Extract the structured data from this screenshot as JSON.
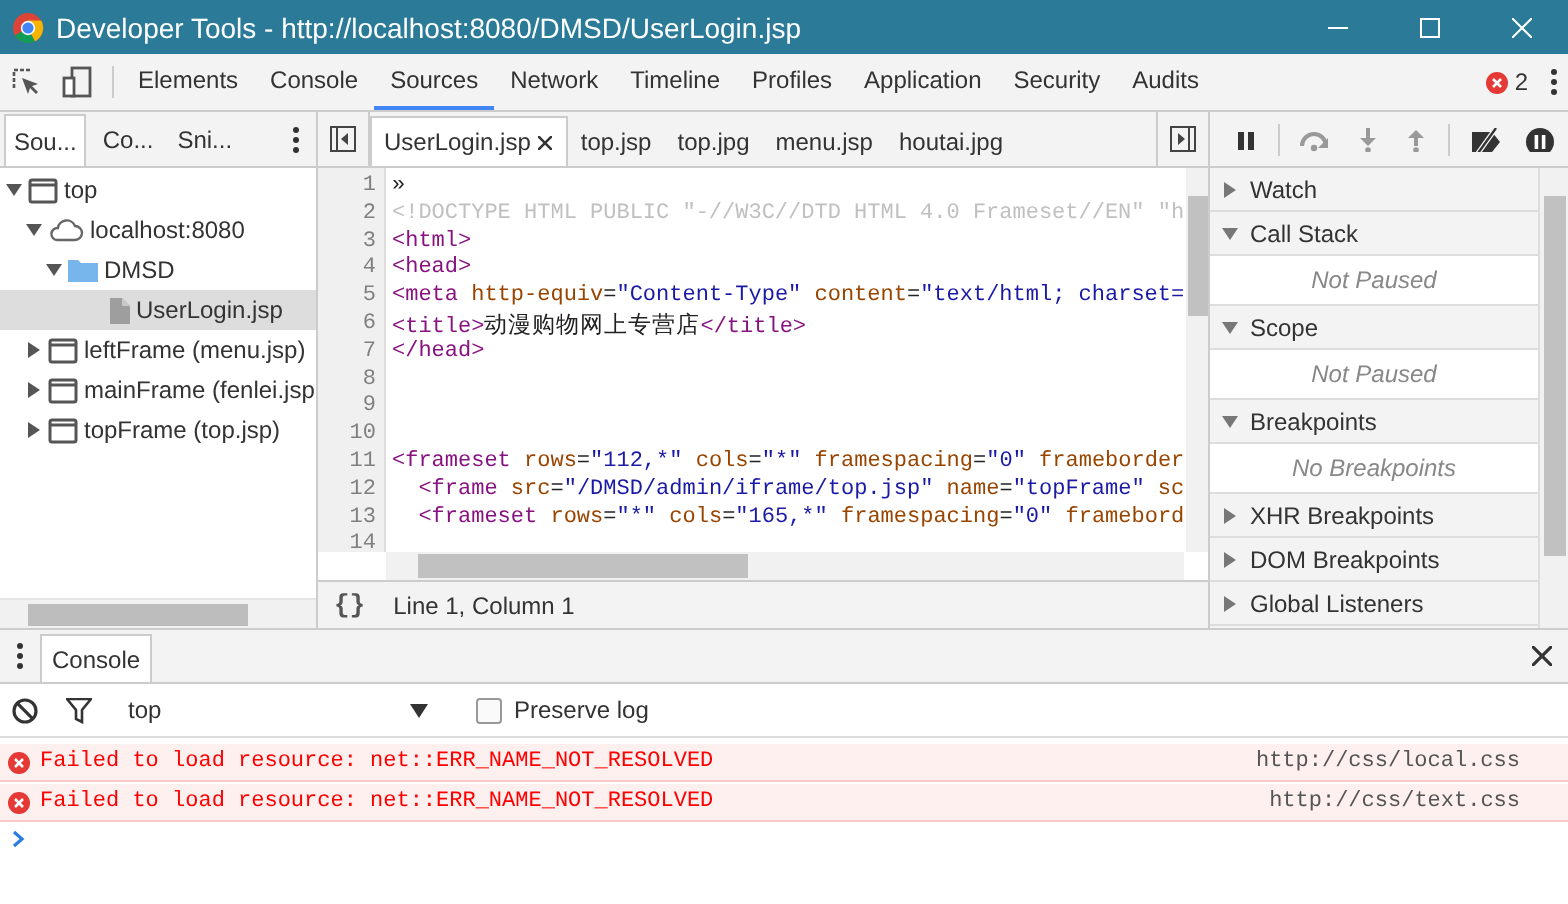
{
  "window": {
    "title": "Developer Tools - http://localhost:8080/DMSD/UserLogin.jsp"
  },
  "tabs": [
    {
      "label": "Elements",
      "selected": false
    },
    {
      "label": "Console",
      "selected": false
    },
    {
      "label": "Sources",
      "selected": true
    },
    {
      "label": "Network",
      "selected": false
    },
    {
      "label": "Timeline",
      "selected": false
    },
    {
      "label": "Profiles",
      "selected": false
    },
    {
      "label": "Application",
      "selected": false
    },
    {
      "label": "Security",
      "selected": false
    },
    {
      "label": "Audits",
      "selected": false
    }
  ],
  "error_count": "2",
  "navigator": {
    "tabs": [
      {
        "label": "Sou...",
        "selected": true
      },
      {
        "label": "Co...",
        "selected": false
      },
      {
        "label": "Sni...",
        "selected": false
      }
    ],
    "tree": [
      {
        "label": "top",
        "kind": "frame",
        "expanded": true,
        "selected": false,
        "children": [
          {
            "label": "localhost:8080",
            "kind": "origin",
            "expanded": true,
            "selected": false,
            "children": [
              {
                "label": "DMSD",
                "kind": "folder",
                "expanded": true,
                "selected": false,
                "children": [
                  {
                    "label": "UserLogin.jsp",
                    "kind": "file",
                    "selected": true
                  }
                ]
              }
            ]
          },
          {
            "label": "leftFrame (menu.jsp)",
            "kind": "frame",
            "expanded": false,
            "selected": false
          },
          {
            "label": "mainFrame (fenlei.jsp",
            "kind": "frame",
            "expanded": false,
            "selected": false
          },
          {
            "label": "topFrame (top.jsp)",
            "kind": "frame",
            "expanded": false,
            "selected": false
          }
        ]
      }
    ]
  },
  "editor": {
    "tabs": [
      {
        "label": "UserLogin.jsp",
        "selected": true
      },
      {
        "label": "top.jsp",
        "selected": false
      },
      {
        "label": "top.jpg",
        "selected": false
      },
      {
        "label": "menu.jsp",
        "selected": false
      },
      {
        "label": "houtai.jpg",
        "selected": false
      }
    ],
    "lines": [
      {
        "number": "1",
        "tokens": [
          {
            "kind": "text",
            "text": "»"
          }
        ]
      },
      {
        "number": "2",
        "tokens": [
          {
            "kind": "comment",
            "text": "<!DOCTYPE HTML PUBLIC \"-//W3C//DTD HTML 4.0 Frameset//EN\" \"h"
          }
        ]
      },
      {
        "number": "3",
        "tokens": [
          {
            "kind": "tag",
            "text": "<html>"
          }
        ]
      },
      {
        "number": "4",
        "tokens": [
          {
            "kind": "tag",
            "text": "<head>"
          }
        ]
      },
      {
        "number": "5",
        "tokens": [
          {
            "kind": "tag",
            "text": "<meta "
          },
          {
            "kind": "attr",
            "text": "http-equiv"
          },
          {
            "kind": "text",
            "text": "="
          },
          {
            "kind": "value",
            "text": "\"Content-Type\""
          },
          {
            "kind": "attr",
            "text": " content"
          },
          {
            "kind": "text",
            "text": "="
          },
          {
            "kind": "value",
            "text": "\"text/html; charset="
          }
        ]
      },
      {
        "number": "6",
        "tokens": [
          {
            "kind": "tag",
            "text": "<title>"
          },
          {
            "kind": "text",
            "text": "动漫购物网上专营店"
          },
          {
            "kind": "tag",
            "text": "</title>"
          }
        ]
      },
      {
        "number": "7",
        "tokens": [
          {
            "kind": "tag",
            "text": "</head>"
          }
        ]
      },
      {
        "number": "8"
      },
      {
        "number": "9"
      },
      {
        "number": "10"
      },
      {
        "number": "11",
        "tokens": [
          {
            "kind": "tag",
            "text": "<frameset "
          },
          {
            "kind": "attr",
            "text": "rows"
          },
          {
            "kind": "text",
            "text": "="
          },
          {
            "kind": "value",
            "text": "\"112,*\""
          },
          {
            "kind": "attr",
            "text": " cols"
          },
          {
            "kind": "text",
            "text": "="
          },
          {
            "kind": "value",
            "text": "\"*\""
          },
          {
            "kind": "attr",
            "text": " framespacing"
          },
          {
            "kind": "text",
            "text": "="
          },
          {
            "kind": "value",
            "text": "\"0\""
          },
          {
            "kind": "attr",
            "text": " frameborder"
          }
        ]
      },
      {
        "number": "12",
        "tokens": [
          {
            "kind": "tag",
            "text": "  <frame "
          },
          {
            "kind": "attr",
            "text": "src"
          },
          {
            "kind": "text",
            "text": "="
          },
          {
            "kind": "value",
            "text": "\"/DMSD/admin/iframe/top.jsp\""
          },
          {
            "kind": "attr",
            "text": " name"
          },
          {
            "kind": "text",
            "text": "="
          },
          {
            "kind": "value",
            "text": "\"topFrame\""
          },
          {
            "kind": "attr",
            "text": " sc"
          }
        ]
      },
      {
        "number": "13",
        "tokens": [
          {
            "kind": "tag",
            "text": "  <frameset "
          },
          {
            "kind": "attr",
            "text": "rows"
          },
          {
            "kind": "text",
            "text": "="
          },
          {
            "kind": "value",
            "text": "\"*\""
          },
          {
            "kind": "attr",
            "text": " cols"
          },
          {
            "kind": "text",
            "text": "="
          },
          {
            "kind": "value",
            "text": "\"165,*\""
          },
          {
            "kind": "attr",
            "text": " framespacing"
          },
          {
            "kind": "text",
            "text": "="
          },
          {
            "kind": "value",
            "text": "\"0\""
          },
          {
            "kind": "attr",
            "text": " framebord"
          }
        ]
      },
      {
        "number": "14"
      }
    ],
    "format_button": "{}",
    "position": "Line 1, Column 1"
  },
  "sidebar": {
    "sections": [
      {
        "title": "Watch",
        "expanded": false
      },
      {
        "title": "Call Stack",
        "expanded": true,
        "message": "Not Paused"
      },
      {
        "title": "Scope",
        "expanded": true,
        "message": "Not Paused"
      },
      {
        "title": "Breakpoints",
        "expanded": true,
        "message": "No Breakpoints"
      },
      {
        "title": "XHR Breakpoints",
        "expanded": false
      },
      {
        "title": "DOM Breakpoints",
        "expanded": false
      },
      {
        "title": "Global Listeners",
        "expanded": false
      }
    ]
  },
  "console": {
    "tab": {
      "label": "Console",
      "selected": true
    },
    "context": "top",
    "preserve_log": {
      "label": "Preserve log",
      "checked": false
    },
    "messages": [
      {
        "kind": "error",
        "text": "Failed to load resource: net::ERR_NAME_NOT_RESOLVED",
        "source": "http://css/local.css"
      },
      {
        "kind": "error",
        "text": "Failed to load resource: net::ERR_NAME_NOT_RESOLVED",
        "source": "http://css/text.css"
      }
    ]
  }
}
